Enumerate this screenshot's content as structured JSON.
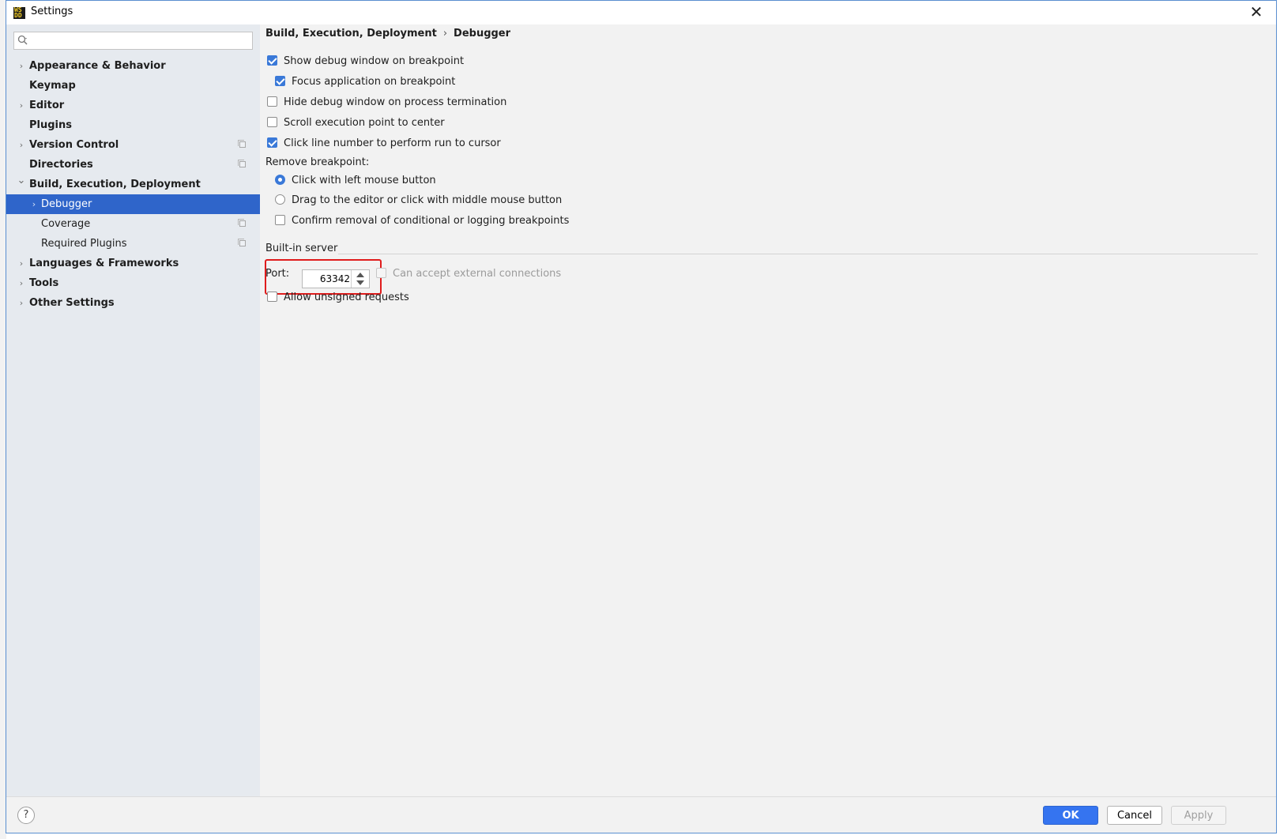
{
  "window": {
    "title": "Settings",
    "app_icon_text": [
      "WS",
      "DD"
    ],
    "close_glyph": "✕"
  },
  "sidebar": {
    "search": {
      "value": "",
      "placeholder": ""
    },
    "items": [
      {
        "label": "Appearance & Behavior",
        "level": 0,
        "expand": "collapsed",
        "project_icon": false,
        "selected": false
      },
      {
        "label": "Keymap",
        "level": 0,
        "expand": "none",
        "project_icon": false,
        "selected": false
      },
      {
        "label": "Editor",
        "level": 0,
        "expand": "collapsed",
        "project_icon": false,
        "selected": false
      },
      {
        "label": "Plugins",
        "level": 0,
        "expand": "none",
        "project_icon": false,
        "selected": false
      },
      {
        "label": "Version Control",
        "level": 0,
        "expand": "collapsed",
        "project_icon": true,
        "selected": false
      },
      {
        "label": "Directories",
        "level": 0,
        "expand": "none",
        "project_icon": true,
        "selected": false
      },
      {
        "label": "Build, Execution, Deployment",
        "level": 0,
        "expand": "expanded",
        "project_icon": false,
        "selected": false
      },
      {
        "label": "Debugger",
        "level": 1,
        "expand": "collapsed",
        "project_icon": false,
        "selected": true
      },
      {
        "label": "Coverage",
        "level": 1,
        "expand": "none",
        "project_icon": true,
        "selected": false
      },
      {
        "label": "Required Plugins",
        "level": 1,
        "expand": "none",
        "project_icon": true,
        "selected": false
      },
      {
        "label": "Languages & Frameworks",
        "level": 0,
        "expand": "collapsed",
        "project_icon": false,
        "selected": false
      },
      {
        "label": "Tools",
        "level": 0,
        "expand": "collapsed",
        "project_icon": false,
        "selected": false
      },
      {
        "label": "Other Settings",
        "level": 0,
        "expand": "collapsed",
        "project_icon": false,
        "selected": false
      }
    ]
  },
  "breadcrumb": {
    "parent": "Build, Execution, Deployment",
    "separator": "›",
    "current": "Debugger"
  },
  "debugger": {
    "show_debug_window": {
      "label": "Show debug window on breakpoint",
      "checked": true
    },
    "focus_application": {
      "label": "Focus application on breakpoint",
      "checked": true
    },
    "hide_debug_window": {
      "label": "Hide debug window on process termination",
      "checked": false
    },
    "scroll_execution_point": {
      "label": "Scroll execution point to center",
      "checked": false
    },
    "click_line_number": {
      "label": "Click line number to perform run to cursor",
      "checked": true
    },
    "remove_breakpoint_label": "Remove breakpoint:",
    "remove_left_click": {
      "label": "Click with left mouse button",
      "selected": true
    },
    "remove_drag": {
      "label": "Drag to the editor or click with middle mouse button",
      "selected": false
    },
    "confirm_removal": {
      "label": "Confirm removal of conditional or logging breakpoints",
      "checked": false
    }
  },
  "builtin_server": {
    "section_title": "Built-in server",
    "port_label": "Port:",
    "port_value": "63342",
    "external_connections": {
      "label": "Can accept external connections",
      "checked": false,
      "enabled": false
    },
    "allow_unsigned": {
      "label": "Allow unsigned requests",
      "checked": false
    }
  },
  "footer": {
    "help_glyph": "?",
    "ok_label": "OK",
    "cancel_label": "Cancel",
    "apply_label": "Apply"
  },
  "colors": {
    "accent": "#3574f0",
    "selection": "#2f65ca",
    "highlight_box": "#e01c1c"
  }
}
